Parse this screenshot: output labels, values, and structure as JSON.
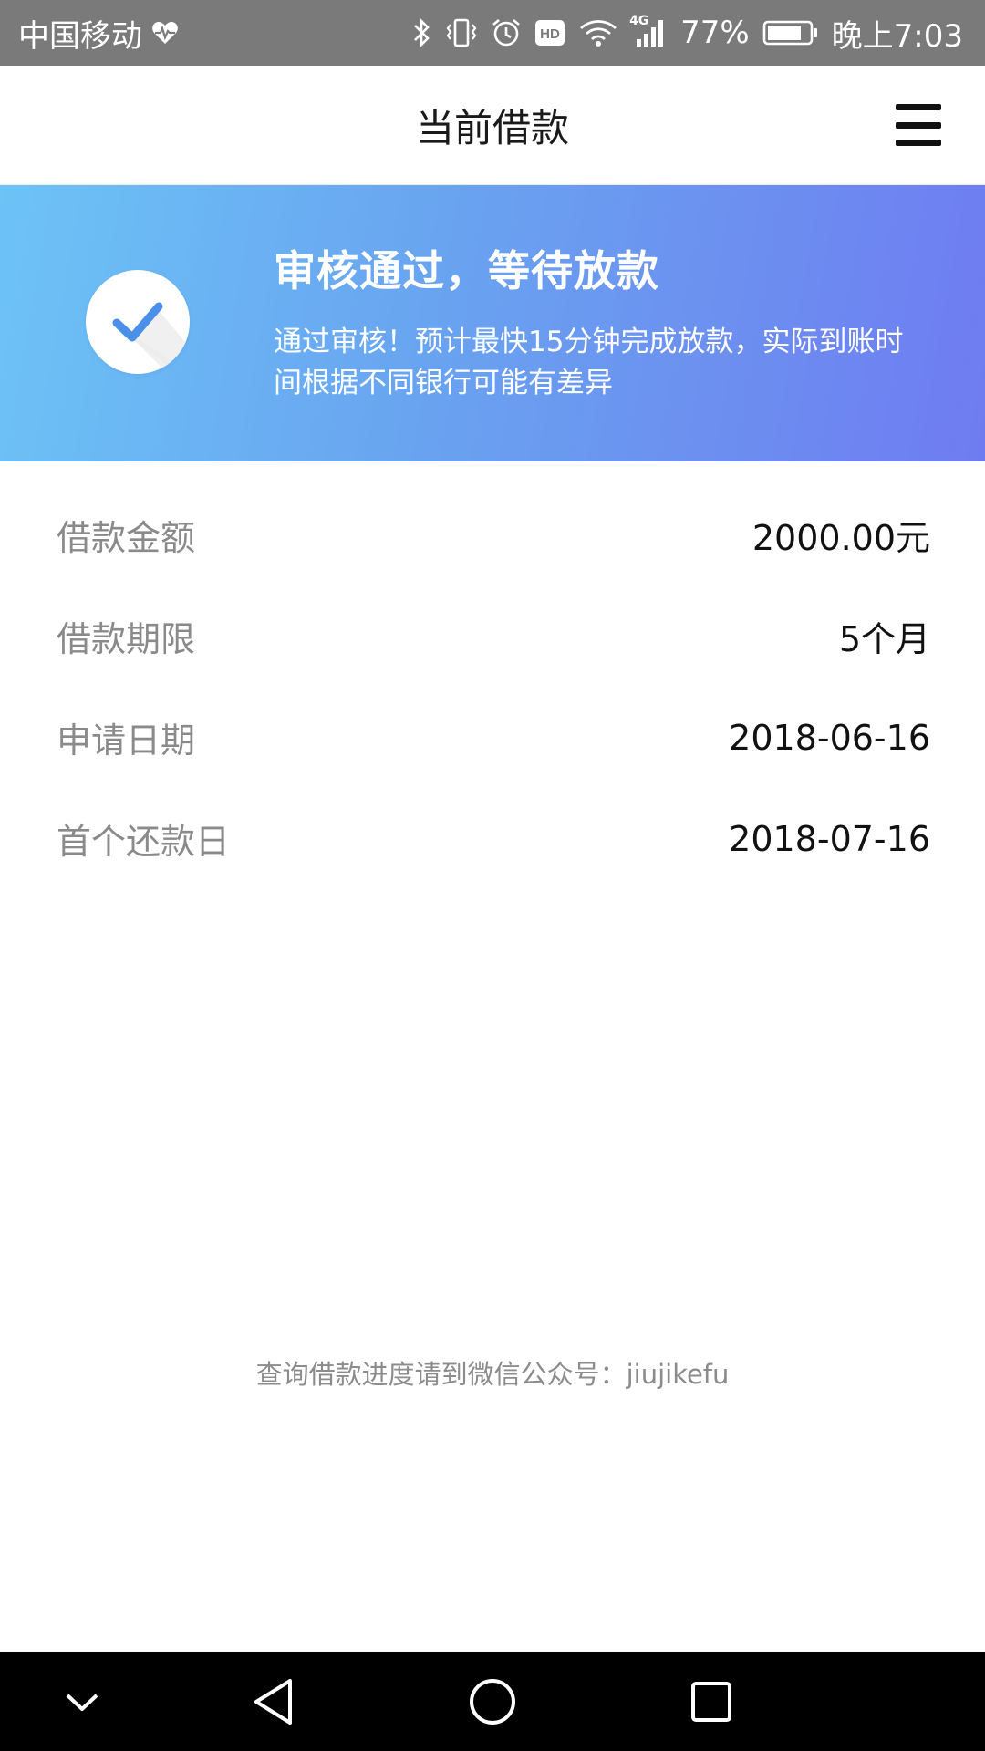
{
  "status_bar": {
    "carrier": "中国移动",
    "network_type": "4G",
    "battery_percent": "77%",
    "time": "晚上7:03",
    "hd_badge": "HD",
    "icons": [
      "heart-pulse-icon",
      "bluetooth-icon",
      "vibrate-icon",
      "alarm-icon",
      "hd-icon",
      "wifi-icon",
      "signal-icon",
      "battery-icon"
    ]
  },
  "header": {
    "title": "当前借款",
    "menu_icon": "hamburger-menu-icon"
  },
  "banner": {
    "title": "审核通过，等待放款",
    "description": "通过审核！预计最快15分钟完成放款，实际到账时间根据不同银行可能有差异",
    "icon": "check-circle-icon",
    "colors": {
      "gradient_start": "#6cc3f6",
      "gradient_end": "#6f7cf1",
      "check": "#4a90e8"
    }
  },
  "details": [
    {
      "label": "借款金额",
      "value": "2000.00元"
    },
    {
      "label": "借款期限",
      "value": "5个月"
    },
    {
      "label": "申请日期",
      "value": "2018-06-16"
    },
    {
      "label": "首个还款日",
      "value": "2018-07-16"
    }
  ],
  "footer_note": "查询借款进度请到微信公众号：jiujikefu",
  "nav_bar": {
    "icons": [
      "chevron-down-icon",
      "back-triangle-icon",
      "home-circle-icon",
      "recents-square-icon"
    ]
  }
}
